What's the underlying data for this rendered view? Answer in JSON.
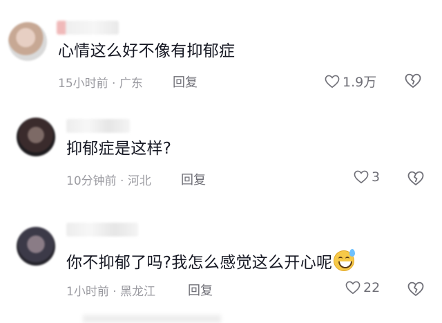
{
  "comments": [
    {
      "text": "心情这么好不像有抑郁症",
      "meta": "15小时前 · 广东",
      "reply_label": "回复",
      "likes": "1.9万"
    },
    {
      "text": "抑郁症是这样?",
      "meta": "10分钟前 · 河北",
      "reply_label": "回复",
      "likes": "3"
    },
    {
      "text": "你不抑郁了吗?我怎么感觉这么开心呢",
      "meta": "1小时前 · 黑龙江",
      "reply_label": "回复",
      "likes": "22"
    }
  ],
  "icons": {
    "like": "heart-outline-icon",
    "dislike": "broken-heart-icon",
    "emoji": "grinning-sweat-emoji"
  },
  "colors": {
    "text": "#161823",
    "meta": "#9a9aa0",
    "action": "#6f6f77"
  }
}
